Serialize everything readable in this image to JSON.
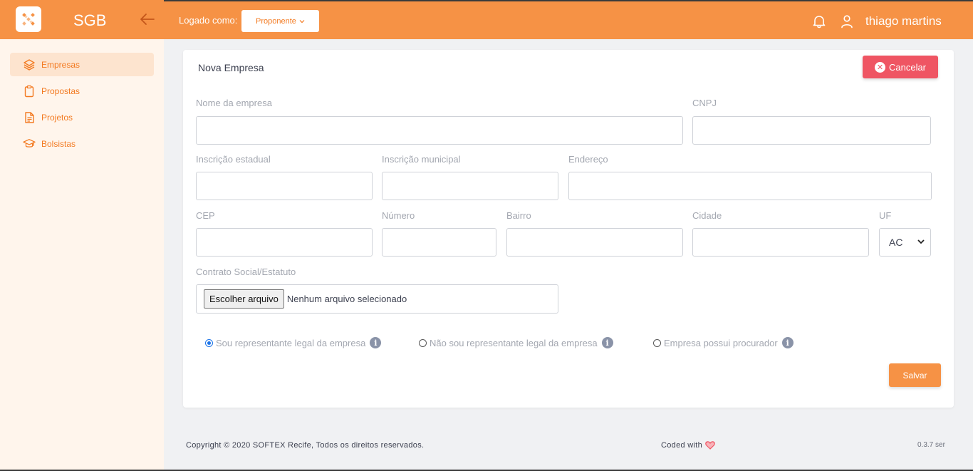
{
  "sidebar": {
    "brand": "SGB",
    "items": [
      {
        "label": "Empresas",
        "icon": "layers-icon",
        "active": true
      },
      {
        "label": "Propostas",
        "icon": "clipboard-icon",
        "active": false
      },
      {
        "label": "Projetos",
        "icon": "document-icon",
        "active": false
      },
      {
        "label": "Bolsistas",
        "icon": "graduation-cap-icon",
        "active": false
      }
    ]
  },
  "topbar": {
    "logged_label": "Logado como:",
    "role_value": "Proponente",
    "username": "thiago martins"
  },
  "card": {
    "title": "Nova Empresa",
    "cancel_label": "Cancelar",
    "save_label": "Salvar"
  },
  "form": {
    "nome_label": "Nome da empresa",
    "cnpj_label": "CNPJ",
    "inscricao_estadual_label": "Inscrição estadual",
    "inscricao_municipal_label": "Inscrição municipal",
    "endereco_label": "Endereço",
    "cep_label": "CEP",
    "numero_label": "Número",
    "bairro_label": "Bairro",
    "cidade_label": "Cidade",
    "uf_label": "UF",
    "uf_value": "AC",
    "contrato_label": "Contrato Social/Estatuto",
    "file_button": "Escolher arquivo",
    "file_status": "Nenhum arquivo selecionado",
    "radios": [
      {
        "label": "Sou representante legal da empresa",
        "checked": true
      },
      {
        "label": "Não sou representante legal da empresa",
        "checked": false
      },
      {
        "label": "Empresa possui procurador",
        "checked": false
      }
    ]
  },
  "footer": {
    "copyright": "Copyright © 2020 SOFTEX Recife, Todos os direitos reservados.",
    "coded_with": "Coded with",
    "version": "0.3.7 ser"
  },
  "colors": {
    "accent": "#f69245",
    "danger": "#ef5563",
    "sidebar_bg": "#fff5ec"
  }
}
